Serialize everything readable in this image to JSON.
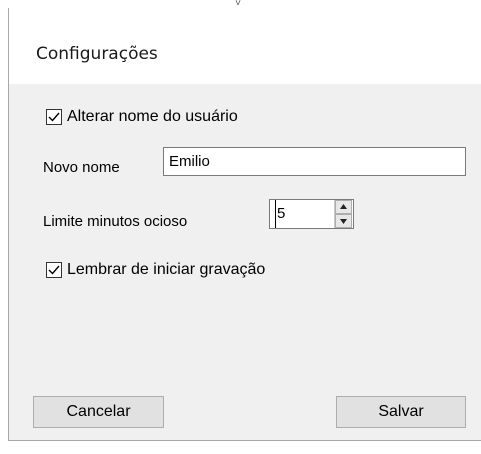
{
  "window": {
    "title": "Configurações"
  },
  "options": {
    "rename_user": {
      "label": "Alterar nome do usuário",
      "checked": true
    },
    "new_name": {
      "label": "Novo nome",
      "value": "Emilio"
    },
    "idle_limit": {
      "label": "Limite minutos ocioso",
      "value": "5"
    },
    "remember_recording": {
      "label": "Lembrar de iniciar gravação",
      "checked": true
    }
  },
  "buttons": {
    "cancel_label": "Cancelar",
    "save_label": "Salvar"
  },
  "icons": {
    "caret": "chevron-down-icon",
    "check": "check-icon",
    "spin_up": "arrow-up-icon",
    "spin_down": "arrow-down-icon"
  }
}
